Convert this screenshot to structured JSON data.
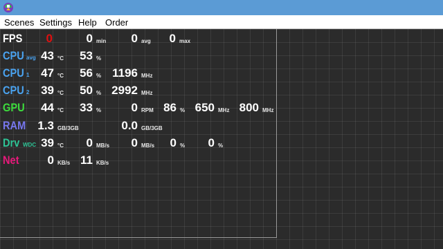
{
  "menu": [
    "Scenes",
    "Settings",
    "Help",
    "Order"
  ],
  "colors": {
    "fps": "#ffffff",
    "cpu": "#4aa3f0",
    "gpu": "#3ddc3d",
    "ram": "#7777ee",
    "drv": "#2ec496",
    "net": "#e6197a",
    "fps_value": "#e01010"
  },
  "rows": {
    "fps": {
      "label": "FPS",
      "value": "0",
      "min": "0",
      "min_unit": "min",
      "avg": "0",
      "avg_unit": "avg",
      "max": "0",
      "max_unit": "max"
    },
    "cpu_avg": {
      "label": "CPU",
      "sub": "avg",
      "temp": "43",
      "temp_unit": "°C",
      "load": "53",
      "load_unit": "%"
    },
    "cpu_1": {
      "label": "CPU",
      "sub": "1",
      "temp": "47",
      "temp_unit": "°C",
      "load": "56",
      "load_unit": "%",
      "clock": "1196",
      "clock_unit": "MHz"
    },
    "cpu_2": {
      "label": "CPU",
      "sub": "2",
      "temp": "39",
      "temp_unit": "°C",
      "load": "50",
      "load_unit": "%",
      "clock": "2992",
      "clock_unit": "MHz"
    },
    "gpu": {
      "label": "GPU",
      "temp": "44",
      "temp_unit": "°C",
      "load": "33",
      "load_unit": "%",
      "fan": "0",
      "fan_unit": "RPM",
      "fanpct": "86",
      "fanpct_unit": "%",
      "core": "650",
      "core_unit": "MHz",
      "mem": "800",
      "mem_unit": "MHz"
    },
    "ram": {
      "label": "RAM",
      "sys": "1.3",
      "sys_unit": "GB/3GB",
      "vram": "0.0",
      "vram_unit": "GB/3GB"
    },
    "drv": {
      "label": "Drv",
      "sub": "WDC",
      "temp": "39",
      "temp_unit": "°C",
      "read": "0",
      "read_unit": "MB/s",
      "write": "0",
      "write_unit": "MB/s",
      "act1": "0",
      "act1_unit": "%",
      "act2": "0",
      "act2_unit": "%"
    },
    "net": {
      "label": "Net",
      "down": "0",
      "down_unit": "KB/s",
      "up": "11",
      "up_unit": "KB/s"
    }
  }
}
